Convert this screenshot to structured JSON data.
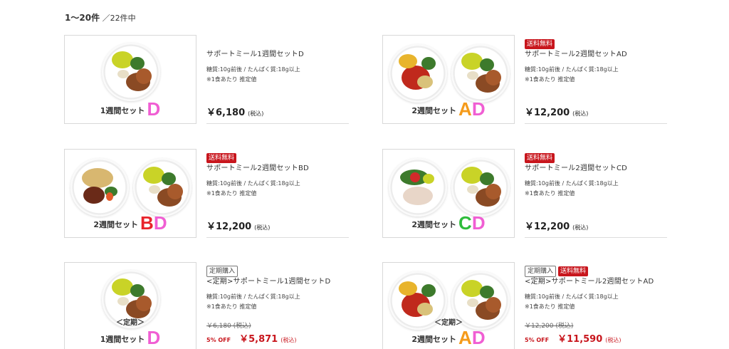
{
  "result": {
    "range": "1〜20",
    "unit": "件",
    "total": "／22件中"
  },
  "colors": {
    "D": "#f05ed3",
    "A": "#f59b1b",
    "B": "#e8232b",
    "C": "#2ebc3b",
    "free_shipping": "#c8161d"
  },
  "products": [
    {
      "thumb": {
        "prefix": "",
        "label": "1週間セット",
        "letters": [
          "D"
        ]
      },
      "tags": [],
      "name": "サポートミール1週間セットD",
      "spec": "糖質:10g前後 / たんぱく質:18g以上",
      "note": "※1食あたり 推定値",
      "price": "￥6,180",
      "tax": "(税込)"
    },
    {
      "thumb": {
        "prefix": "",
        "label": "2週間セット",
        "letters": [
          "A",
          "D"
        ]
      },
      "tags": [
        "送料無料"
      ],
      "name": "サポートミール2週間セットAD",
      "spec": "糖質:10g前後 / たんぱく質:18g以上",
      "note": "※1食あたり 推定値",
      "price": "￥12,200",
      "tax": "(税込)"
    },
    {
      "thumb": {
        "prefix": "",
        "label": "2週間セット",
        "letters": [
          "B",
          "D"
        ]
      },
      "tags": [
        "送料無料"
      ],
      "name": "サポートミール2週間セットBD",
      "spec": "糖質:10g前後 / たんぱく質:18g以上",
      "note": "※1食あたり 推定値",
      "price": "￥12,200",
      "tax": "(税込)"
    },
    {
      "thumb": {
        "prefix": "",
        "label": "2週間セット",
        "letters": [
          "C",
          "D"
        ]
      },
      "tags": [
        "送料無料"
      ],
      "name": "サポートミール2週間セットCD",
      "spec": "糖質:10g前後 / たんぱく質:18g以上",
      "note": "※1食あたり 推定値",
      "price": "￥12,200",
      "tax": "(税込)"
    },
    {
      "thumb": {
        "prefix": "＜定期＞",
        "label": "1週間セット",
        "letters": [
          "D"
        ]
      },
      "tags": [
        "定期購入"
      ],
      "name": "<定期>サポートミール1週間セットD",
      "spec": "糖質:10g前後 / たんぱく質:18g以上",
      "note": "※1食あたり 推定値",
      "old_price": "￥6,180 (税込)",
      "discount": "5% OFF",
      "price": "￥5,871",
      "tax": "(税込)"
    },
    {
      "thumb": {
        "prefix": "＜定期＞",
        "label": "2週間セット",
        "letters": [
          "A",
          "D"
        ]
      },
      "tags": [
        "定期購入",
        "送料無料"
      ],
      "name": "<定期>サポートミール2週間セットAD",
      "spec": "糖質:10g前後 / たんぱく質:18g以上",
      "note": "※1食あたり 推定値",
      "old_price": "￥12,200 (税込)",
      "discount": "5% OFF",
      "price": "￥11,590",
      "tax": "(税込)"
    }
  ]
}
